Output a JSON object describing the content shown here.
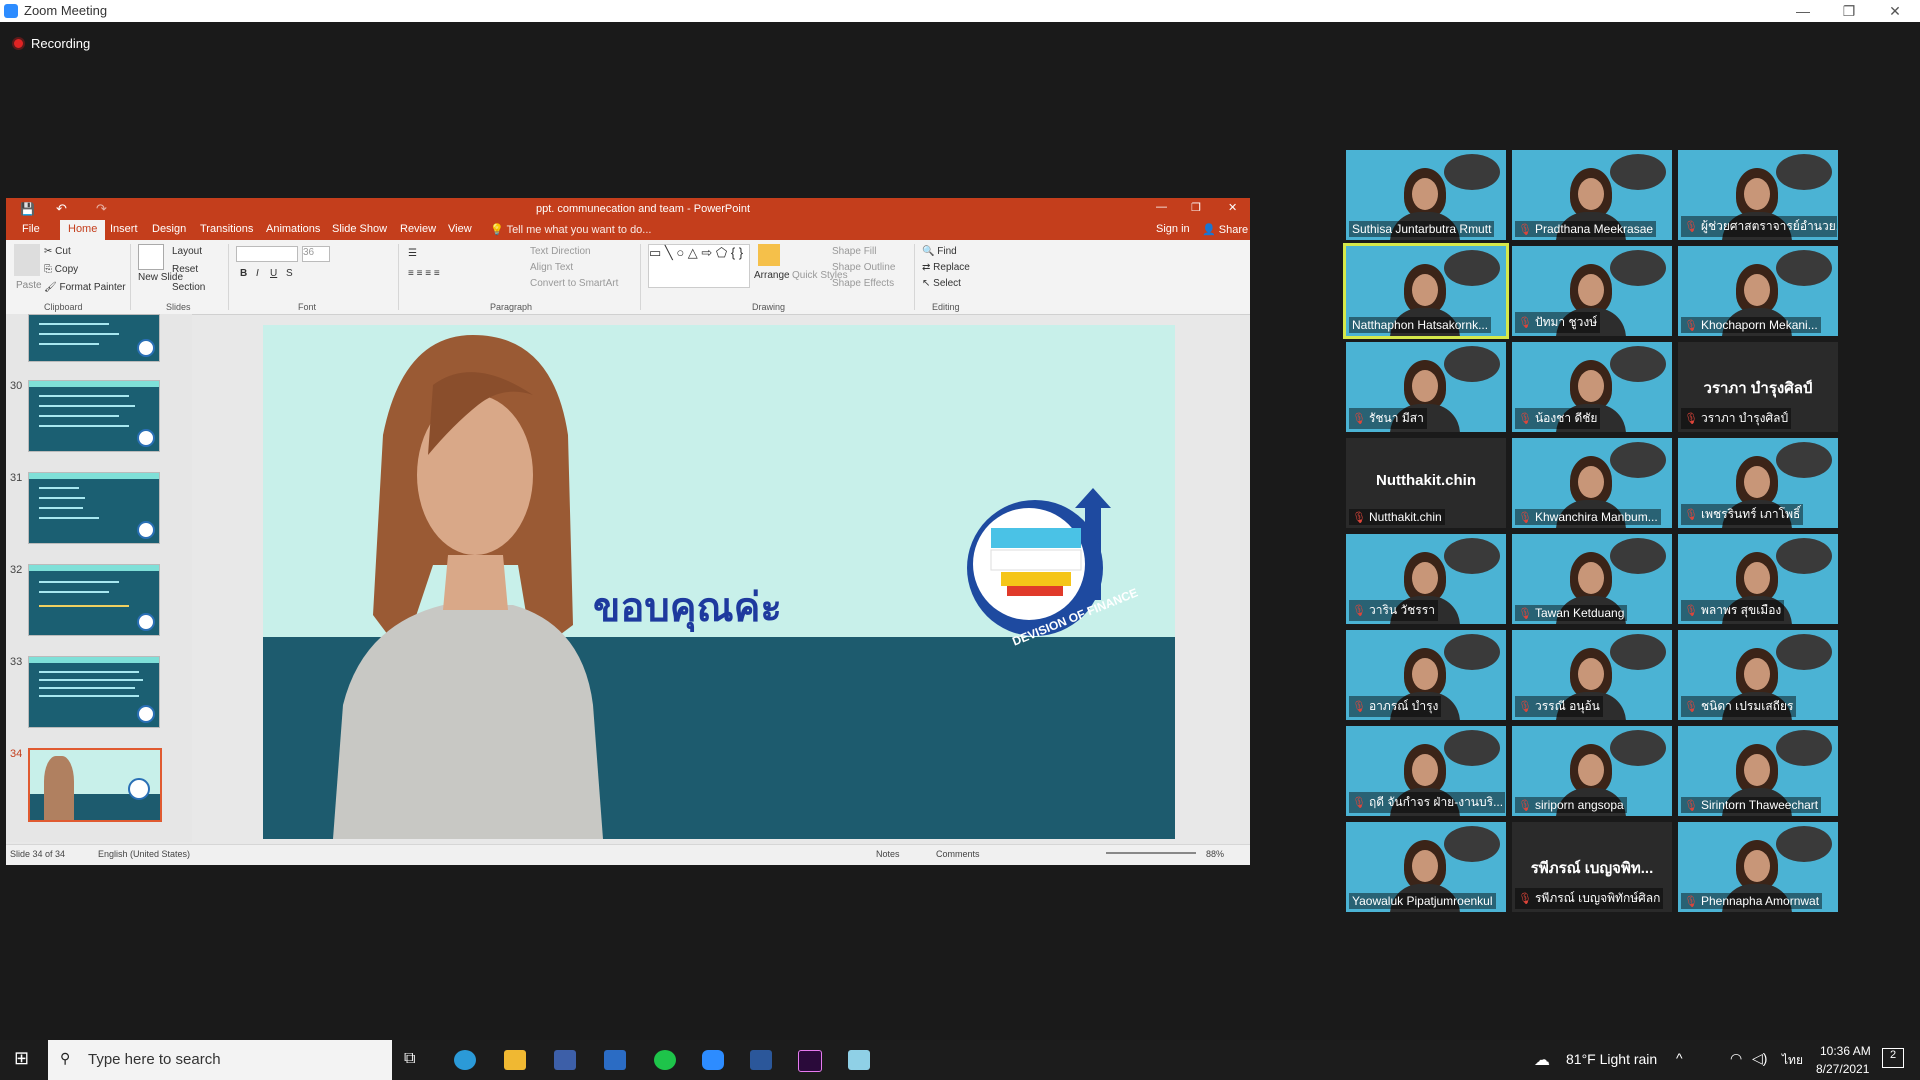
{
  "zoom": {
    "title": "Zoom Meeting",
    "recording": "Recording"
  },
  "ppt": {
    "title": "ppt. communecation and team - PowerPoint",
    "tabs": [
      "File",
      "Home",
      "Insert",
      "Design",
      "Transitions",
      "Animations",
      "Slide Show",
      "Review",
      "View"
    ],
    "tell_me": "Tell me what you want to do...",
    "sign_in": "Sign in",
    "share": "Share",
    "ribbon": {
      "paste": "Paste",
      "cut": "Cut",
      "copy": "Copy",
      "format_painter": "Format Painter",
      "new_slide": "New Slide",
      "layout": "Layout",
      "reset": "Reset",
      "section": "Section",
      "font_size": "36",
      "text_direction": "Text Direction",
      "align_text": "Align Text",
      "convert_smartart": "Convert to SmartArt",
      "arrange": "Arrange",
      "quick_styles": "Quick Styles",
      "shape_fill": "Shape Fill",
      "shape_outline": "Shape Outline",
      "shape_effects": "Shape Effects",
      "find": "Find",
      "replace": "Replace",
      "select": "Select",
      "groups": [
        "Clipboard",
        "Slides",
        "Font",
        "Paragraph",
        "Drawing",
        "Editing"
      ]
    },
    "thumbs": [
      "30",
      "31",
      "32",
      "33",
      "34"
    ],
    "slide": {
      "thai_text": "ขอบคุณค่ะ",
      "logo_text": "DEVISION OF FINANCE"
    },
    "status": {
      "slide": "Slide 34 of 34",
      "lang": "English (United States)",
      "notes": "Notes",
      "comments": "Comments",
      "zoom": "88%"
    }
  },
  "participants": [
    {
      "name": "Suthisa Juntarbutra Rmutt",
      "muted": false,
      "video": true
    },
    {
      "name": "Pradthana Meekrasae",
      "muted": true,
      "video": true
    },
    {
      "name": "ผู้ช่วยศาสตราจารย์อำนวย...",
      "muted": true,
      "video": true
    },
    {
      "name": "Natthaphon Hatsakornk...",
      "muted": false,
      "video": true,
      "active": true
    },
    {
      "name": "ปัทมา ชูวงษ์",
      "muted": true,
      "video": true
    },
    {
      "name": "Khochaporn Mekani...",
      "muted": true,
      "video": true
    },
    {
      "name": "รัชนา มีสา",
      "muted": true,
      "video": true
    },
    {
      "name": "น้องชา ดีชัย",
      "muted": true,
      "video": true
    },
    {
      "name": "วราภา บำรุงศิลป์",
      "muted": true,
      "video": false,
      "big": "วราภา บำรุงศิลป์"
    },
    {
      "name": "Nutthakit.chin",
      "muted": true,
      "video": false,
      "big": "Nutthakit.chin"
    },
    {
      "name": "Khwanchira Manbum...",
      "muted": true,
      "video": true
    },
    {
      "name": "เพชรรินทร์ เภาโพธิ์",
      "muted": true,
      "video": true
    },
    {
      "name": "วาริน วัชรรา",
      "muted": true,
      "video": true
    },
    {
      "name": "Tawan Ketduang",
      "muted": true,
      "video": true
    },
    {
      "name": "พลาพร สุขเมือง",
      "muted": true,
      "video": true
    },
    {
      "name": "อาภรณ์ บำรุง",
      "muted": true,
      "video": true
    },
    {
      "name": "วรรณี อนุอ้น",
      "muted": true,
      "video": true
    },
    {
      "name": "ชนิดา เปรมเสถียร",
      "muted": true,
      "video": true
    },
    {
      "name": "ฤดี จันกำจร ฝ่าย-งานบริ...",
      "muted": true,
      "video": true
    },
    {
      "name": "siriporn angsopa",
      "muted": true,
      "video": true
    },
    {
      "name": "Sirintorn Thaweechart",
      "muted": true,
      "video": true
    },
    {
      "name": "Yaowaluk Pipatjumroenkul",
      "muted": false,
      "video": true
    },
    {
      "name": "รพีภรณ์ เบญจพิทักษ์ศิลก",
      "muted": true,
      "video": false,
      "big": "รพีภรณ์ เบญจพิท..."
    },
    {
      "name": "Phennapha Amornwat",
      "muted": true,
      "video": true
    }
  ],
  "taskbar": {
    "search_placeholder": "Type here to search",
    "weather": "81°F  Light rain",
    "lang": "ไทย",
    "time": "10:36 AM",
    "date": "8/27/2021",
    "notif": "2"
  }
}
